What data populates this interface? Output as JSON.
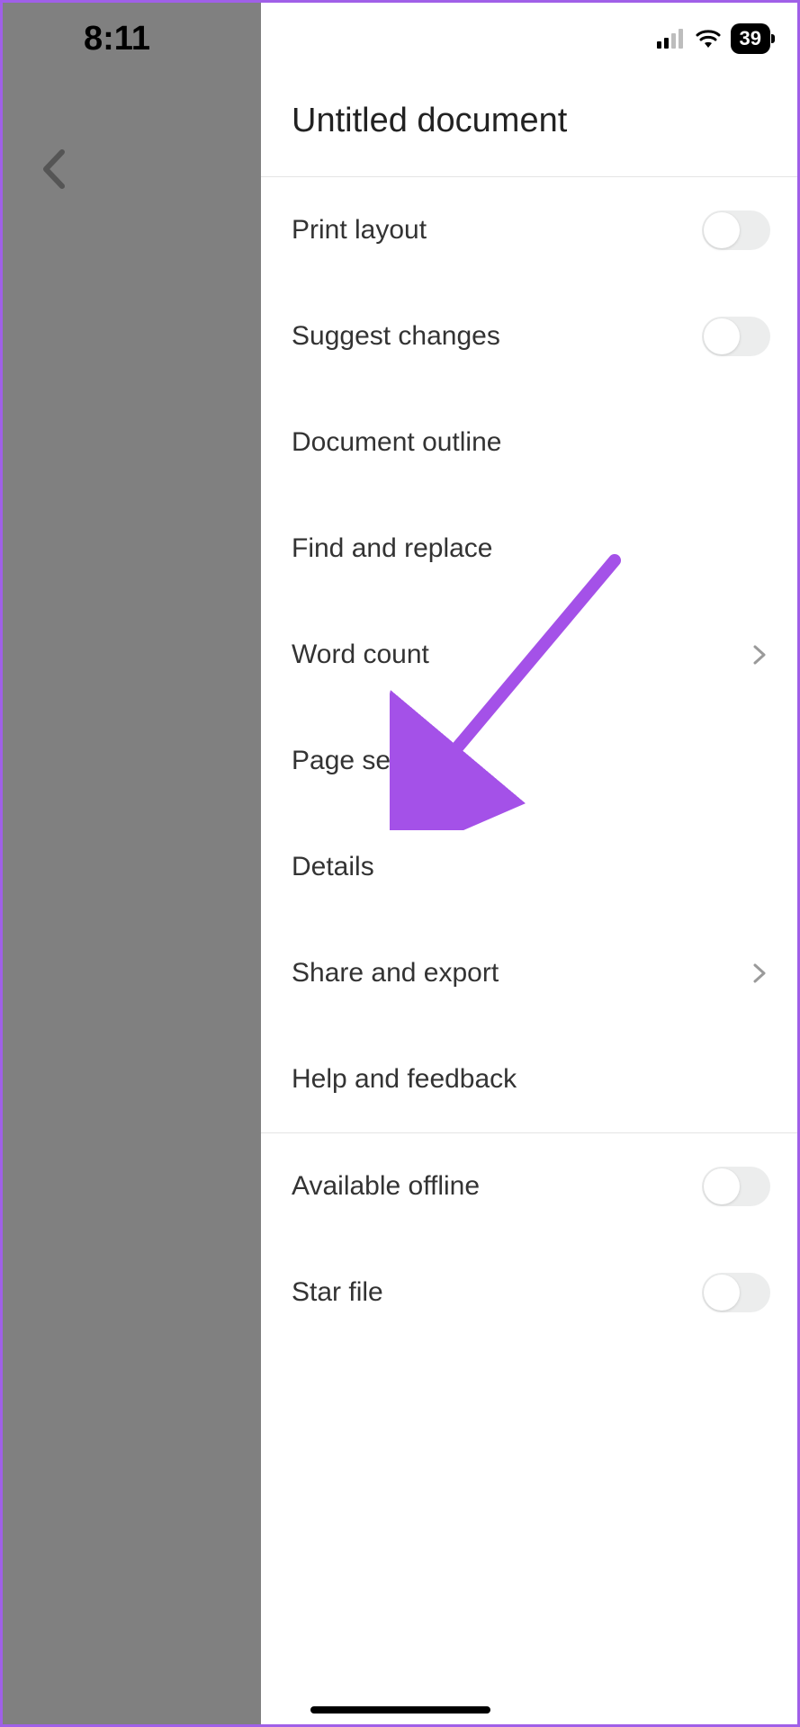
{
  "status_bar": {
    "time": "8:11",
    "battery_percent": "39"
  },
  "panel": {
    "title": "Untitled document"
  },
  "menu": {
    "print_layout": "Print layout",
    "suggest_changes": "Suggest changes",
    "document_outline": "Document outline",
    "find_and_replace": "Find and replace",
    "word_count": "Word count",
    "page_setup": "Page setup",
    "details": "Details",
    "share_and_export": "Share and export",
    "help_and_feedback": "Help and feedback",
    "available_offline": "Available offline",
    "star_file": "Star file"
  },
  "toggles": {
    "print_layout": false,
    "suggest_changes": false,
    "available_offline": false,
    "star_file": false
  },
  "annotation": {
    "color": "#a451e8",
    "target": "page_setup"
  }
}
